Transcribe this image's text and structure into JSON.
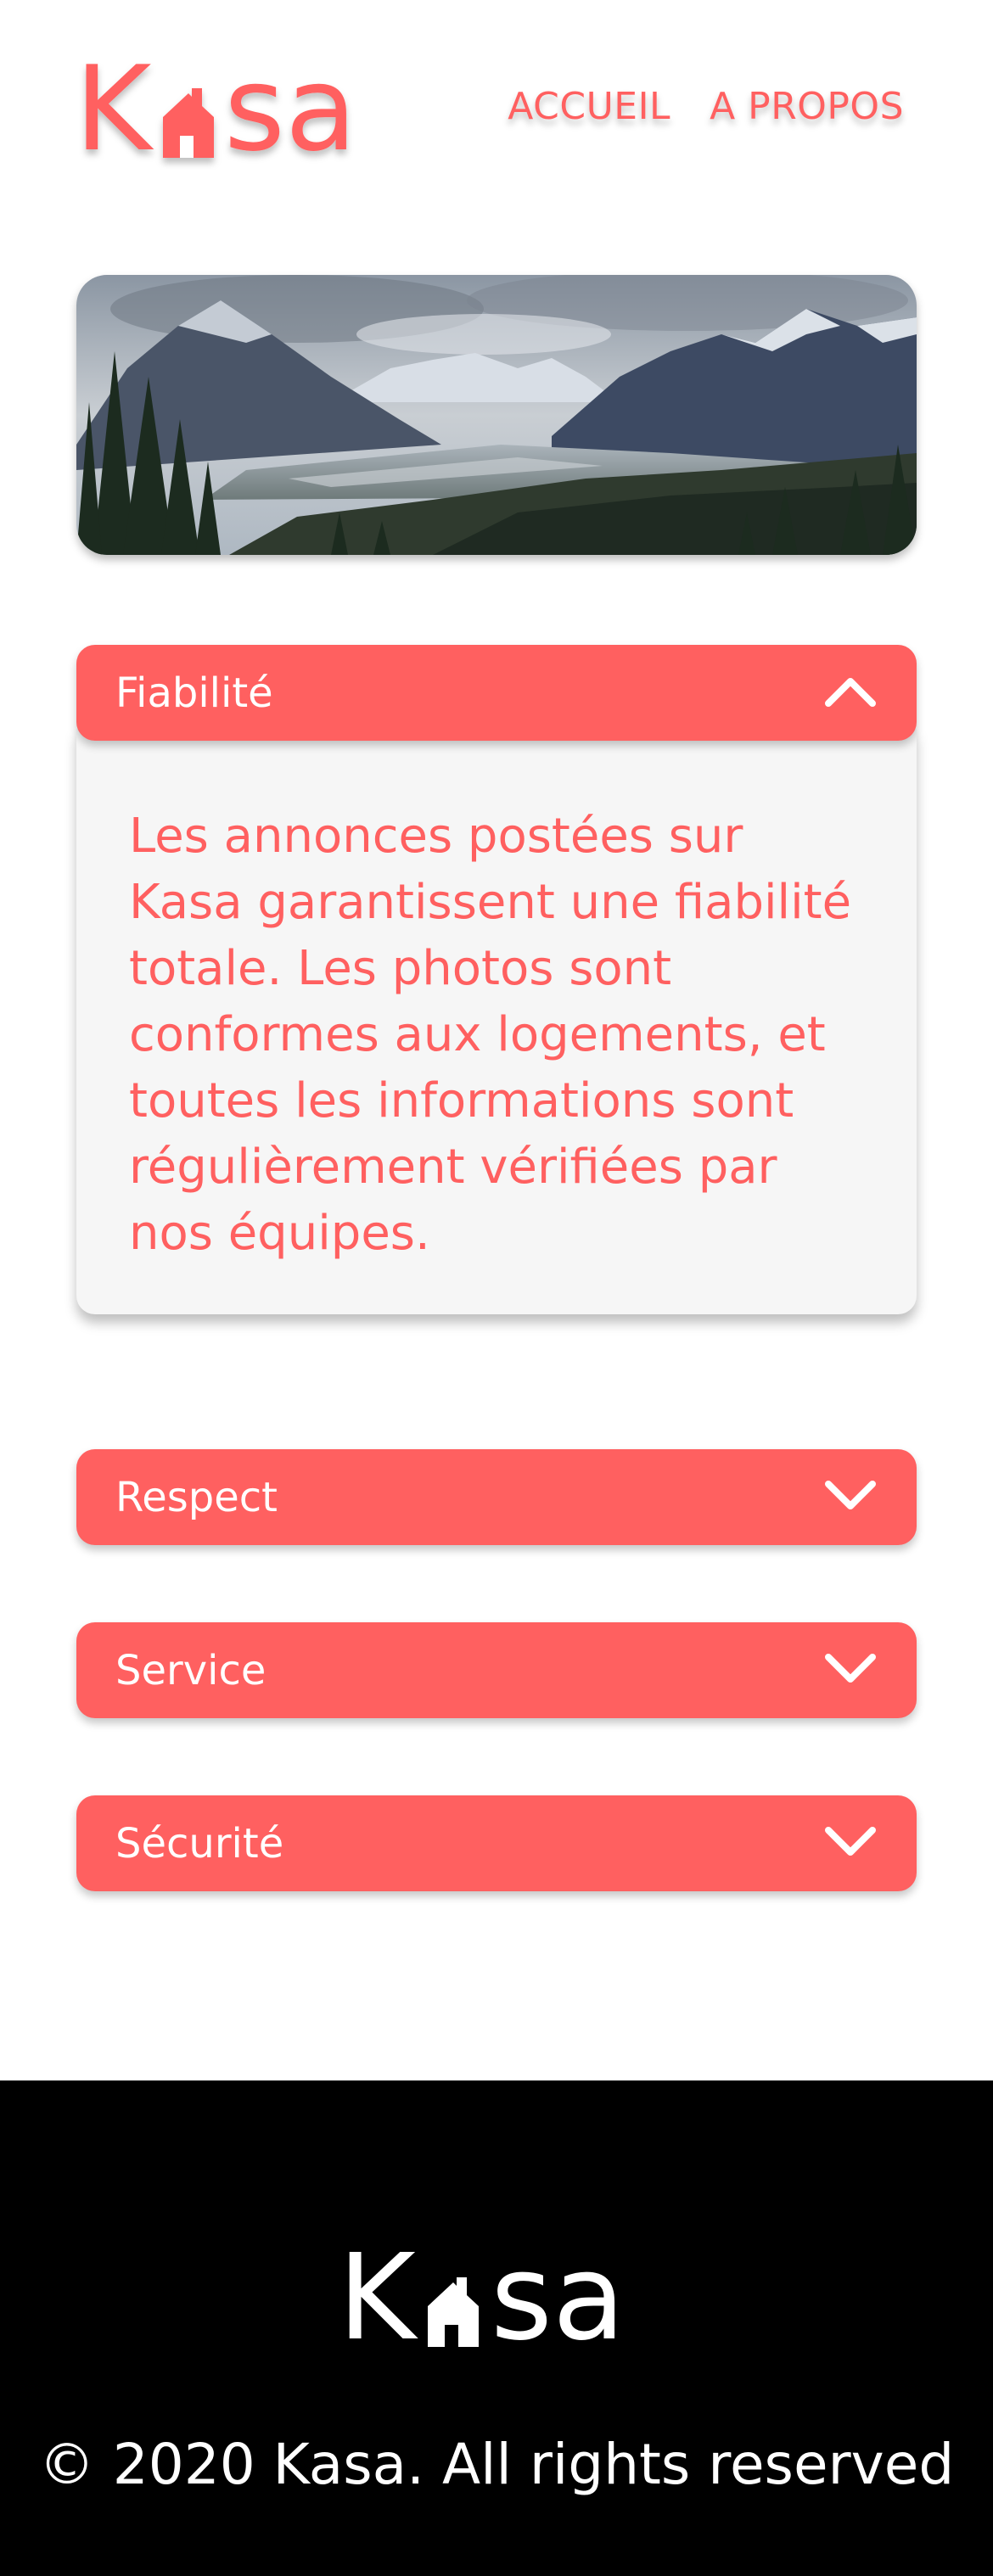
{
  "brand": {
    "name": "Kasa",
    "accent_color": "#FF6060",
    "logo_letter_left": "K",
    "logo_letters_right": "sa"
  },
  "nav": {
    "items": [
      {
        "label": "ACCUEIL"
      },
      {
        "label": "A PROPOS"
      }
    ]
  },
  "banner": {
    "image": "mountain-landscape-banner"
  },
  "accordion": {
    "items": [
      {
        "title": "Fiabilité",
        "expanded": true,
        "icon": "chevron-up-icon",
        "content": "Les annonces postées sur Kasa garantissent une fiabilité totale. Les photos sont conformes aux logements, et toutes les informations sont régulièrement vérifiées par nos équipes."
      },
      {
        "title": "Respect",
        "expanded": false,
        "icon": "chevron-down-icon"
      },
      {
        "title": "Service",
        "expanded": false,
        "icon": "chevron-down-icon"
      },
      {
        "title": "Sécurité",
        "expanded": false,
        "icon": "chevron-down-icon"
      }
    ]
  },
  "footer": {
    "background": "#000000",
    "text_color": "#FFFFFF",
    "copyright": "© 2020 Kasa. All rights reserved"
  }
}
